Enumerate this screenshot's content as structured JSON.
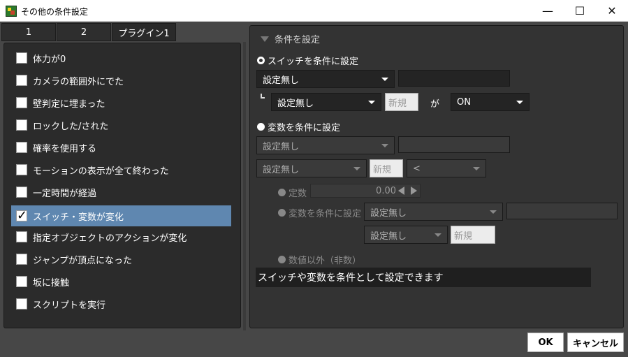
{
  "window": {
    "title": "その他の条件設定",
    "minimize": "—",
    "maximize": "☐",
    "close": "✕"
  },
  "tabs": [
    "1",
    "2",
    "プラグイン1"
  ],
  "conditions": [
    {
      "label": "体力が0",
      "checked": false
    },
    {
      "label": "カメラの範囲外にでた",
      "checked": false
    },
    {
      "label": "壁判定に埋まった",
      "checked": false
    },
    {
      "label": "ロックした/された",
      "checked": false
    },
    {
      "label": "確率を使用する",
      "checked": false
    },
    {
      "label": "モーションの表示が全て終わった",
      "checked": false
    },
    {
      "label": "一定時間が経過",
      "checked": false
    },
    {
      "label": "スイッチ・変数が変化",
      "checked": true
    },
    {
      "label": "指定オブジェクトのアクションが変化",
      "checked": false
    },
    {
      "label": "ジャンプが頂点になった",
      "checked": false
    },
    {
      "label": "坂に接触",
      "checked": false
    },
    {
      "label": "スクリプトを実行",
      "checked": false
    }
  ],
  "panel": {
    "header": "条件を設定",
    "switch_radio": "スイッチを条件に設定",
    "switch_select1": "設定無し",
    "switch_select2": "設定無し",
    "new_label": "新規",
    "ga": "が",
    "switch_state": "ON",
    "var_radio": "変数を条件に設定",
    "var_select1": "設定無し",
    "var_select2": "設定無し",
    "operator": "<",
    "const_radio": "定数",
    "const_value": "0.00",
    "var_compare_radio": "変数を条件に設定",
    "var_compare_select1": "設定無し",
    "var_compare_select2": "設定無し",
    "non_numeric_radio": "数値以外（非数）",
    "description": "スイッチや変数を条件として設定できます"
  },
  "footer": {
    "ok": "OK",
    "cancel": "キャンセル"
  },
  "colors": {
    "selected_row": "#5f87b0",
    "panel_bg": "#333333",
    "window_bg": "#474747"
  }
}
